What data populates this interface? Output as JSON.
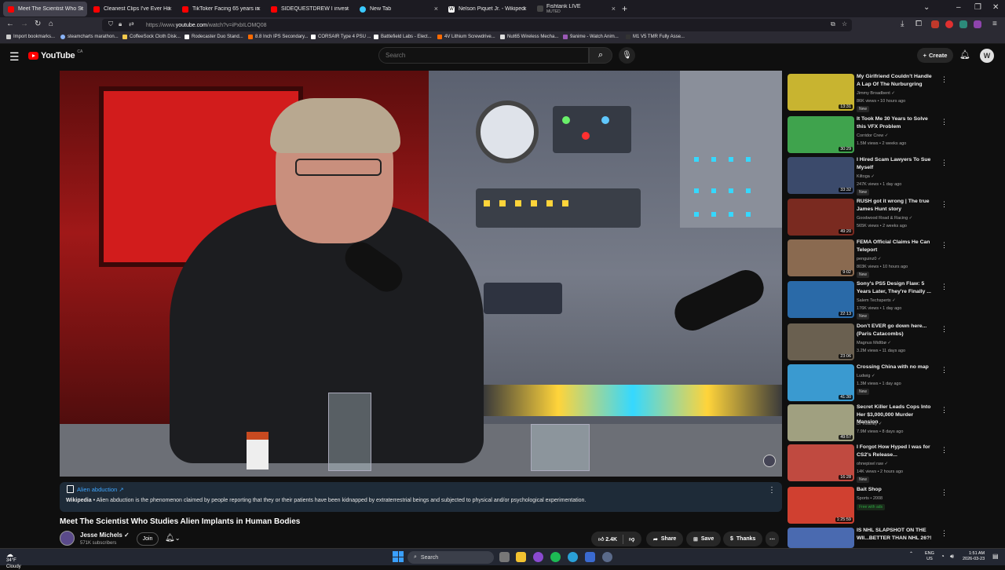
{
  "browser": {
    "tabs": [
      {
        "label": "Meet The Scientist Who Studie",
        "color": "#ff0000",
        "active": true
      },
      {
        "label": "Cleanest Clips I've Ever Hit... (Al",
        "color": "#ff0000"
      },
      {
        "label": "TikToker Facing 65 years in Pris",
        "color": "#ff0000"
      },
      {
        "label": "SIDEQUESTDREW I investigate",
        "color": "#ff0000"
      },
      {
        "label": "New Tab",
        "color": "#3ac9ff"
      },
      {
        "label": "Nelson Piquet Jr. - Wikipedia",
        "color": "#ffffff"
      },
      {
        "label": "Fishtank LIVE",
        "sub": "MUTED",
        "color": "#444444"
      }
    ],
    "new_tab_symbol": "+",
    "url_prefix": "https://www.",
    "url_host": "youtube.com",
    "url_rest": "/watch?v=iPxbILOMQ08",
    "bookmarks": [
      {
        "label": "Import bookmarks...",
        "color": "#cccccc"
      },
      {
        "label": "steamcharts marathon...",
        "color": "#8ab4f8"
      },
      {
        "label": "CoffeeSock Cloth Disk...",
        "color": "#f2c94c"
      },
      {
        "label": "Rodecaster Duo Stand...",
        "color": "#ffffff"
      },
      {
        "label": "8.8 Inch IPS Secondary...",
        "color": "#ff6a00"
      },
      {
        "label": "CORSAIR Type 4 PSU ...",
        "color": "#ffffff"
      },
      {
        "label": "Battlefield Labs - Elect...",
        "color": "#ffffff"
      },
      {
        "label": "4V Lithium Screwdrive...",
        "color": "#ff6a00"
      },
      {
        "label": "Nut65 Wireless Mecha...",
        "color": "#dddddd"
      },
      {
        "label": "9anime - Watch Anim...",
        "color": "#9b59b6"
      },
      {
        "label": "M1 V5 TMR Fully Asse...",
        "color": "#333333"
      }
    ]
  },
  "youtube": {
    "logo_text": "YouTube",
    "country": "CA",
    "search_placeholder": "Search",
    "create_label": "Create",
    "avatar_letter": "W"
  },
  "infocard": {
    "title": "Alien abduction ↗",
    "source": "Wikipedia",
    "text": " • Alien abduction is the phenomenon claimed by people reporting that they or their patients have been kidnapped by extraterrestrial beings and subjected to physical and/or psychological experimentation."
  },
  "video": {
    "title": "Meet The Scientist Who Studies Alien Implants in Human Bodies",
    "channel": "Jesse Michels ✓",
    "subscribers": "571K subscribers",
    "join_label": "Join",
    "likes": "2.4K",
    "share_label": "Share",
    "save_label": "Save",
    "thanks_label": "Thanks"
  },
  "recommendations": [
    {
      "title": "My Girlfriend Couldn't Handle A Lap Of The Nurburgring",
      "channel": "Jimmy Broadbent ✓",
      "meta": "86K views • 10 hours ago",
      "badge": "New",
      "duration": "13:31",
      "thumb": "#c8b430"
    },
    {
      "title": "It Took Me 30 Years to Solve this VFX Problem",
      "channel": "Corridor Crew ✓",
      "meta": "1.5M views • 2 weeks ago",
      "badge": "",
      "duration": "30:29",
      "thumb": "#3fa34d"
    },
    {
      "title": "I Hired Scam Lawyers To Sue Myself",
      "channel": "Kiltoga ✓",
      "meta": "247K views • 1 day ago",
      "badge": "New",
      "duration": "33:32",
      "thumb": "#3b4a6b"
    },
    {
      "title": "RUSH got it wrong | The true James Hunt story",
      "channel": "Goodwood Road & Racing ✓",
      "meta": "565K views • 2 weeks ago",
      "badge": "",
      "duration": "49:20",
      "thumb": "#7a2a20"
    },
    {
      "title": "FEMA Official Claims He Can Teleport",
      "channel": "penguinz0 ✓",
      "meta": "803K views • 10 hours ago",
      "badge": "New",
      "duration": "9:02",
      "thumb": "#8a6a50"
    },
    {
      "title": "Sony's PS5 Design Flaw: 5 Years Later, They're Finally ...",
      "channel": "Salem Techsperts ✓",
      "meta": "176K views • 1 day ago",
      "badge": "New",
      "duration": "22:13",
      "thumb": "#2a6aa8"
    },
    {
      "title": "Don't EVER go down here... (Paris Catacombs)",
      "channel": "Magnus Midtbø ✓",
      "meta": "3.2M views • 11 days ago",
      "badge": "",
      "duration": "23:06",
      "thumb": "#6a6050"
    },
    {
      "title": "Crossing China with no map",
      "channel": "Ludwig ✓",
      "meta": "1.3M views • 1 day ago",
      "badge": "New",
      "duration": "41:30",
      "thumb": "#3a9ad0"
    },
    {
      "title": "Secret Killer Leads Cops Into Her $3,000,000 Murder Mansion",
      "channel": "Dr Insanity ✓",
      "meta": "7.9M views • 8 days ago",
      "badge": "",
      "duration": "49:57",
      "thumb": "#a0a080"
    },
    {
      "title": "I Forgot How Hyped I was for CS2's Release...",
      "channel": "ohnepixel raw ✓",
      "meta": "14K views • 2 hours ago",
      "badge": "New",
      "duration": "16:28",
      "thumb": "#c04a40"
    },
    {
      "title": "Bait Shop",
      "channel": "Sports • 2008",
      "meta": "",
      "badge": "Free with ads",
      "duration": "1:25:59",
      "thumb": "#d04030"
    },
    {
      "title": "IS NHL SLAPSHOT ON THE WII...BETTER THAN NHL 26?!",
      "channel": "",
      "meta": "",
      "badge": "",
      "duration": "",
      "thumb": "#4a6ab0"
    }
  ],
  "taskbar": {
    "temp": "34°F",
    "condition": "Cloudy",
    "search_label": "Search",
    "lang_top": "ENG",
    "lang_bottom": "US",
    "time": "1:51 AM",
    "date": "2026-03-23"
  }
}
